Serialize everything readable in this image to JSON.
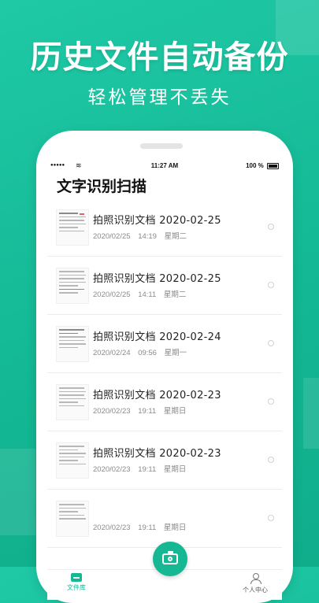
{
  "promo": {
    "headline": "历史文件自动备份",
    "subline": "轻松管理不丢失"
  },
  "status_bar": {
    "time": "11:27 AM",
    "battery": "100 %"
  },
  "app": {
    "title": "文字识别扫描"
  },
  "documents": [
    {
      "title": "拍照识别文档  2020-02-25",
      "date": "2020/02/25",
      "time": "14:19",
      "weekday": "星期二"
    },
    {
      "title": "拍照识别文档  2020-02-25",
      "date": "2020/02/25",
      "time": "14:11",
      "weekday": "星期二"
    },
    {
      "title": "拍照识别文档  2020-02-24",
      "date": "2020/02/24",
      "time": "09:56",
      "weekday": "星期一"
    },
    {
      "title": "拍照识别文档  2020-02-23",
      "date": "2020/02/23",
      "time": "19:11",
      "weekday": "星期日"
    },
    {
      "title": "拍照识别文档  2020-02-23",
      "date": "2020/02/23",
      "time": "19:11",
      "weekday": "星期日"
    },
    {
      "title": "",
      "date": "2020/02/23",
      "time": "19:11",
      "weekday": "星期日"
    }
  ],
  "tabbar": {
    "files_label": "文件库",
    "profile_label": "个人中心"
  },
  "colors": {
    "accent": "#16b894",
    "background_gradient_start": "#1fc9a6",
    "background_gradient_end": "#10ad8b"
  },
  "icons": [
    "signal-icon",
    "wifi-icon",
    "battery-icon",
    "folder-icon",
    "camera-icon",
    "person-icon"
  ]
}
